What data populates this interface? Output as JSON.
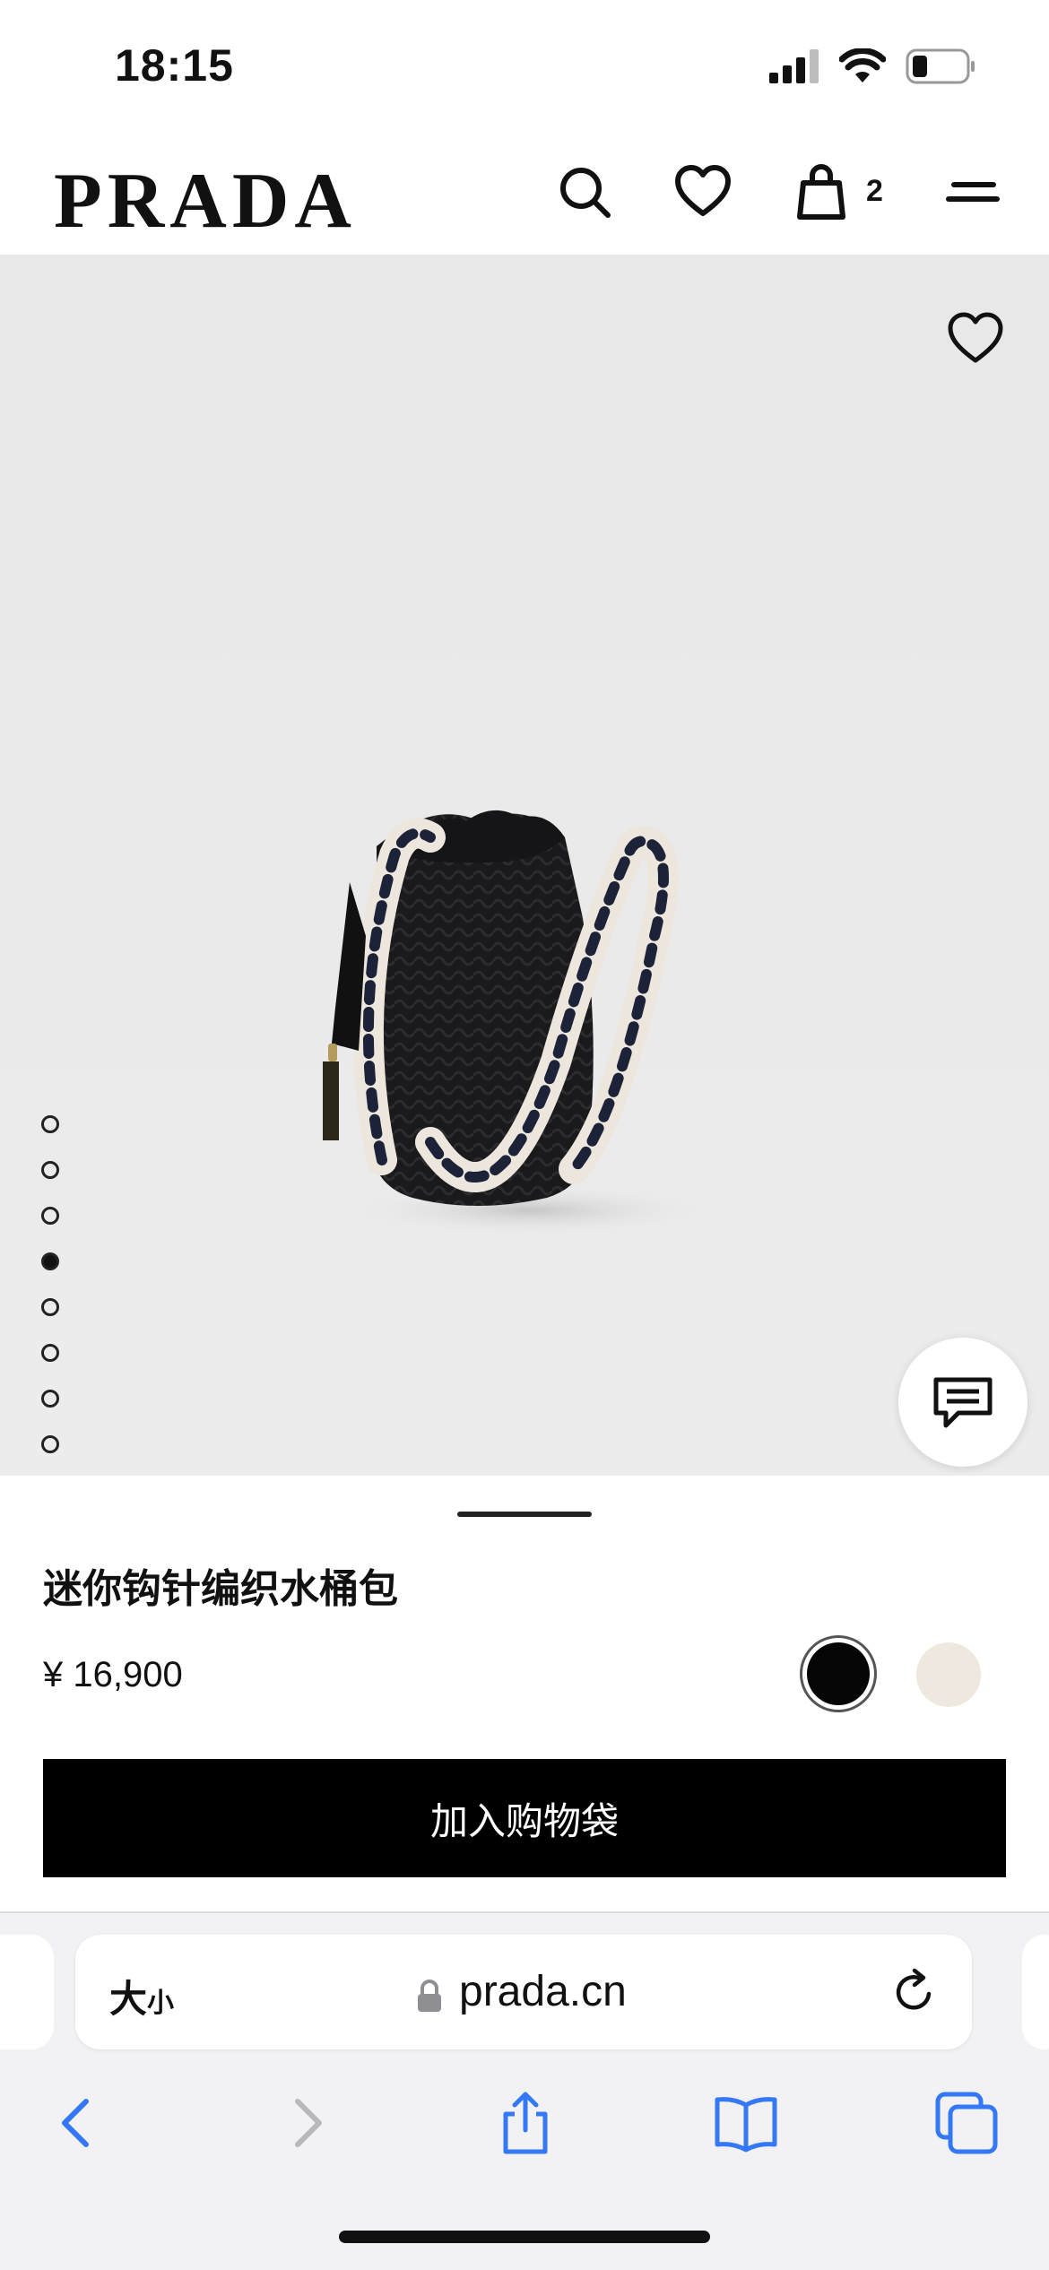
{
  "status_bar": {
    "time": "18:15",
    "icons": [
      "cellular-signal-icon",
      "wifi-icon",
      "battery-icon"
    ]
  },
  "header": {
    "logo": "PRADA",
    "icons": [
      "search-icon",
      "heart-icon",
      "shopping-bag-icon",
      "menu-icon"
    ],
    "bag_count": "2"
  },
  "gallery": {
    "image": "black crochet mini bucket bag with braided cream and navy handles",
    "image_count": 8,
    "active_index": 4,
    "favorite_icon": "heart-icon",
    "chat_icon": "chat-icon"
  },
  "product": {
    "name": "迷你钩针编织水桶包",
    "price": "¥ 16,900",
    "colors": [
      {
        "name": "black",
        "hex": "#050505",
        "selected": true
      },
      {
        "name": "cream",
        "hex": "#efe8de",
        "selected": false
      }
    ],
    "add_to_bag": "加入购物袋"
  },
  "browser": {
    "text_size_label": "大",
    "text_size_small": "小",
    "url": "prada.cn",
    "toolbar_icons": [
      "back-icon",
      "forward-icon",
      "share-icon",
      "bookmarks-icon",
      "tabs-icon"
    ],
    "accent": "#3478f6"
  }
}
